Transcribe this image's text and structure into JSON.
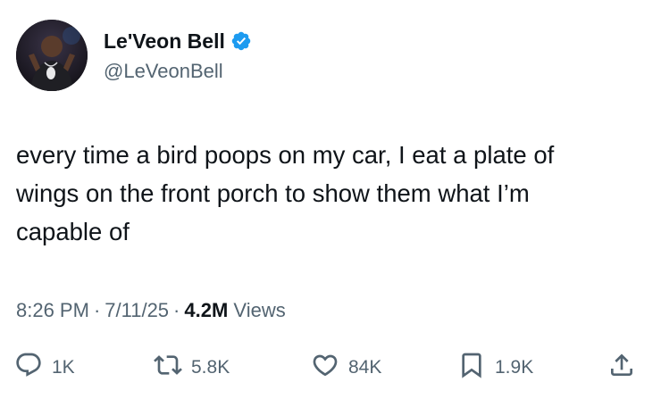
{
  "author": {
    "display_name": "Le'Veon Bell",
    "handle": "@LeVeonBell",
    "verified": true
  },
  "tweet": {
    "text": "every time a bird poops on my car, I eat a plate of\nwings on the front porch to show them what I’m\ncapable of",
    "time": "8:26 PM",
    "date": "7/11/25",
    "views_count": "4.2M",
    "views_label": "Views"
  },
  "actions": {
    "replies": "1K",
    "reposts": "5.8K",
    "likes": "84K",
    "bookmarks": "1.9K"
  },
  "icons": {
    "verified": "verified-badge-icon",
    "reply": "reply-icon",
    "repost": "repost-icon",
    "like": "heart-icon",
    "bookmark": "bookmark-icon",
    "share": "share-icon"
  },
  "colors": {
    "text": "#0f1419",
    "secondary": "#536471",
    "verified_blue": "#1d9bf0"
  }
}
